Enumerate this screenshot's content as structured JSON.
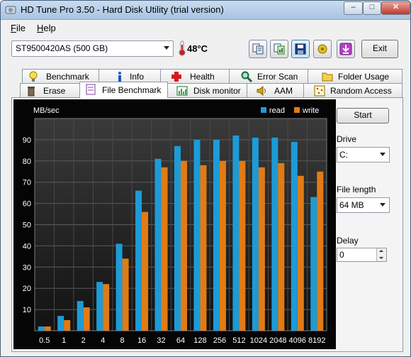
{
  "window": {
    "title": "HD Tune Pro 3.50 - Hard Disk Utility (trial version)",
    "minimize_icon": "minimize-icon",
    "maximize_icon": "maximize-icon",
    "close_icon": "close-icon"
  },
  "menu": [
    {
      "label": "File",
      "accel": "F",
      "rest": "ile"
    },
    {
      "label": "Help",
      "accel": "H",
      "rest": "elp"
    }
  ],
  "toolbar": {
    "drive": "ST9500420AS (500 GB)",
    "temperature": "48°C",
    "buttons": [
      "copy-text-icon",
      "copy-screenshot-icon",
      "save-icon",
      "options-icon",
      "download-icon"
    ],
    "exit_label": "Exit"
  },
  "tabs_top": [
    {
      "label": "Benchmark",
      "icon": "lightbulb-icon"
    },
    {
      "label": "Info",
      "icon": "info-icon"
    },
    {
      "label": "Health",
      "icon": "health-cross-icon"
    },
    {
      "label": "Error Scan",
      "icon": "magnifier-icon"
    },
    {
      "label": "Folder Usage",
      "icon": "folder-icon"
    }
  ],
  "tabs_bottom": [
    {
      "label": "Erase",
      "icon": "trash-icon"
    },
    {
      "label": "File Benchmark",
      "icon": "file-benchmark-icon",
      "active": true
    },
    {
      "label": "Disk monitor",
      "icon": "disk-monitor-icon"
    },
    {
      "label": "AAM",
      "icon": "speaker-icon"
    },
    {
      "label": "Random Access",
      "icon": "random-access-icon"
    }
  ],
  "side": {
    "start_label": "Start",
    "drive_label": "Drive",
    "drive_value": "C:",
    "file_length_label": "File length",
    "file_length_value": "64 MB",
    "delay_label": "Delay",
    "delay_value": "0"
  },
  "chart_data": {
    "type": "bar",
    "ylabel": "MB/sec",
    "ylim": [
      0,
      100
    ],
    "yticks": [
      10,
      20,
      30,
      40,
      50,
      60,
      70,
      80,
      90
    ],
    "categories": [
      "0.5",
      "1",
      "2",
      "4",
      "8",
      "16",
      "32",
      "64",
      "128",
      "256",
      "512",
      "1024",
      "2048",
      "4096",
      "8192"
    ],
    "series": [
      {
        "name": "read",
        "color": "#1d9bd7",
        "values": [
          2,
          7,
          14,
          23,
          41,
          66,
          81,
          87,
          90,
          90,
          92,
          91,
          91,
          89,
          63
        ]
      },
      {
        "name": "write",
        "color": "#e07b16",
        "values": [
          2,
          5,
          11,
          22,
          34,
          56,
          77,
          80,
          78,
          80,
          80,
          77,
          79,
          73,
          75
        ]
      }
    ],
    "legend_position": "top-right",
    "grid": true
  }
}
